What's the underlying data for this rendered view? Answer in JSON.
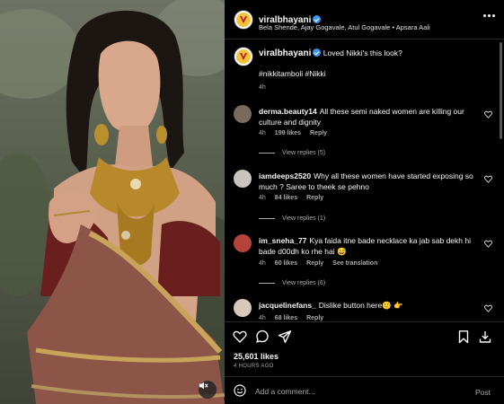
{
  "header": {
    "username": "viralbhayani",
    "subtitle": "Bela Shende, Ajay Gogavale, Atul Gogavale • Apsara Aali",
    "more_icon": "more-horizontal-icon"
  },
  "caption": {
    "username": "viralbhayani",
    "text": "Loved Nikki's this look?",
    "tags": "#nikkitamboli #Nikki",
    "time": "4h"
  },
  "comments": [
    {
      "username": "derma.beauty14",
      "text": "All these semi naked women are killing our culture and dignity",
      "time": "4h",
      "likes": "199 likes",
      "reply_label": "Reply",
      "view_replies": "View replies (5)",
      "avatar_color": "#7a6a5a"
    },
    {
      "username": "iamdeeps2520",
      "text": "Why all these women have started exposing so much ? Saree to theek se pehno",
      "time": "4h",
      "likes": "84 likes",
      "reply_label": "Reply",
      "view_replies": "View replies (1)",
      "avatar_color": "#c9c4bd"
    },
    {
      "username": "im_sneha_77",
      "text": "Kya faida itne bade necklace ka jab sab dekh hi bade d00dh ko rhe hai 😅",
      "time": "4h",
      "likes": "60 likes",
      "reply_label": "Reply",
      "see_translation": "See translation",
      "view_replies": "View replies (6)",
      "avatar_color": "#b5433a"
    },
    {
      "username": "jacquelinefans_",
      "text": "Dislike button here🙂 👉",
      "time": "4h",
      "likes": "68 likes",
      "reply_label": "Reply",
      "avatar_color": "#d8c9b8"
    }
  ],
  "actions": {
    "like_icon": "heart-icon",
    "comment_icon": "comment-icon",
    "share_icon": "send-icon",
    "save_icon": "bookmark-icon",
    "embed_icon": "download-icon"
  },
  "likes_count": "25,601 likes",
  "posted_ago": "4 HOURS AGO",
  "add_comment": {
    "placeholder": "Add a comment...",
    "post_label": "Post"
  },
  "colors": {
    "background": "#000000",
    "muted_text": "#a8a8a8",
    "verified_blue": "#3897f0",
    "brand_yellow": "#f6c23b"
  }
}
